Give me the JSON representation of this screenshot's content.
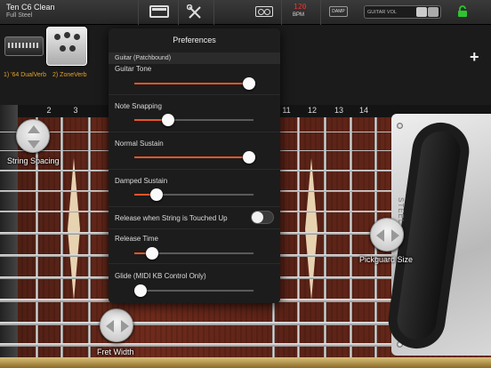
{
  "toolbar": {
    "preset_name": "Ten C6 Clean",
    "preset_sub": "Full Steel",
    "bpm_value": "120",
    "bpm_label": "BPM",
    "damp_label": "DAMP",
    "guitar_vol_label": "GUITAR VOL",
    "icons": [
      "amp-icon",
      "tools-icon",
      "tape-icon",
      "lock-icon"
    ]
  },
  "pedals": [
    {
      "label": "1) '64 DualVerb"
    },
    {
      "label": "2) ZoneVerb"
    }
  ],
  "add_label": "+",
  "fret_numbers": [
    "2",
    "3",
    "11",
    "12",
    "13",
    "14"
  ],
  "handles": {
    "string_spacing": "String Spacing",
    "pickguard_size": "Pickguard Size",
    "fret_width": "Fret Width"
  },
  "pickguard_text": "STEEL",
  "preferences": {
    "title": "Preferences",
    "section": "Guitar (Patchbound)",
    "items": [
      {
        "label": "Guitar Tone",
        "type": "slider",
        "value": 0.96
      },
      {
        "label": "Note Snapping",
        "type": "slider",
        "value": 0.28
      },
      {
        "label": "Normal Sustain",
        "type": "slider",
        "value": 0.96
      },
      {
        "label": "Damped Sustain",
        "type": "slider",
        "value": 0.19
      },
      {
        "label": "Release when String is Touched Up",
        "type": "toggle",
        "value": false
      },
      {
        "label": "Release Time",
        "type": "slider",
        "value": 0.15
      },
      {
        "label": "Glide (MIDI KB Control Only)",
        "type": "slider",
        "value": 0.05
      }
    ]
  },
  "colors": {
    "accent": "#e8552b",
    "pedal_label": "#e2a12b",
    "bpm": "#ee3333",
    "lock": "#2fc42f"
  }
}
